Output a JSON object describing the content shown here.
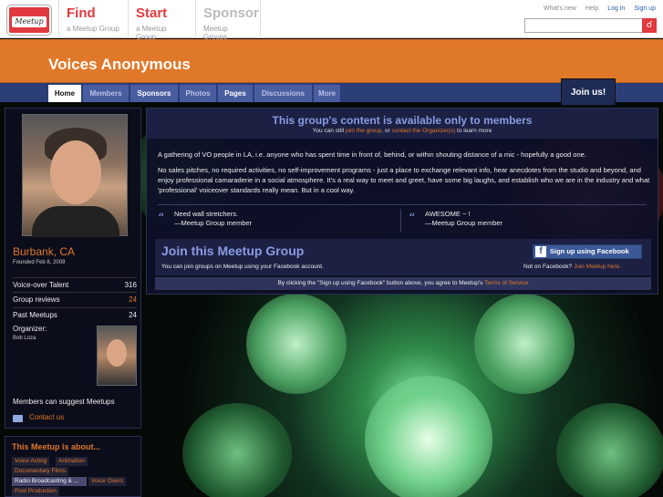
{
  "header": {
    "logo_text": "Meetup",
    "nav": [
      {
        "title": "Find",
        "sub": "a Meetup Group"
      },
      {
        "title": "Start",
        "sub": "a Meetup Group"
      },
      {
        "title": "Sponsor",
        "sub": "Meetup Groups"
      }
    ],
    "links": [
      "What's new",
      "Help",
      "Log in",
      "Sign up"
    ],
    "search_placeholder": "",
    "search_icon": "search-icon"
  },
  "group": {
    "name": "Voices Anonymous",
    "tabs": [
      "Home",
      "Members",
      "Sponsors",
      "Photos",
      "Pages",
      "Discussions",
      "More"
    ],
    "join_label": "Join us!"
  },
  "sidebar": {
    "city": "Burbank, CA",
    "founded": "Founded Feb 8, 2009",
    "stats": [
      {
        "label": "Voice-over Talent",
        "value": "316"
      },
      {
        "label": "Group reviews",
        "value": "24"
      },
      {
        "label": "Past Meetups",
        "value": "24"
      }
    ],
    "organizer_label": "Organizer:",
    "organizer_name": "Bob Loza",
    "suggest": "Members can suggest Meetups",
    "contact": "Contact us",
    "about_title": "This Meetup is about...",
    "topics": [
      "Voice Acting",
      "Animation",
      "Documentary Films",
      "Radio Broadcasting & ...",
      "Voice Overs",
      "Post Production"
    ]
  },
  "main": {
    "members_title": "This group's content is available only to members",
    "members_sub_1": "You can still ",
    "members_sub_link1": "join the group",
    "members_sub_2": ", or ",
    "members_sub_link2": "contact the Organizer(s)",
    "members_sub_3": " to learn more",
    "desc1": "A gathering of VO people in LA, i.e. anyone who has spent time in front of, behind, or within shouting distance of a mic - hopefully a good one.",
    "desc2": "No sales pitches, no required activities, no self-improvement programs - just a place to exchange relevant info, hear anecdotes from the studio and beyond, and enjoy professional camaraderie in a social atmosphere. It's a real way to meet and greet, have some big laughs, and establish who we are in the industry and what 'professional' voiceover standards really mean. But in a cool way.",
    "quotes": [
      {
        "text": "Need wall stretchers.",
        "author": "—Meetup Group member"
      },
      {
        "text": "AWESOME ~ !",
        "author": "—Meetup Group member"
      }
    ],
    "join_title": "Join this Meetup Group",
    "join_sub": "You can join groups on Meetup using your Facebook account.",
    "fb_button": "Sign up using Facebook",
    "not_fb": "Not on Facebook?",
    "not_fb_link": "Join Meetup here.",
    "terms_1": "By clicking the \"Sign up using Facebook\" button above, you agree to Meetup's ",
    "terms_link": "Terms of Service"
  }
}
